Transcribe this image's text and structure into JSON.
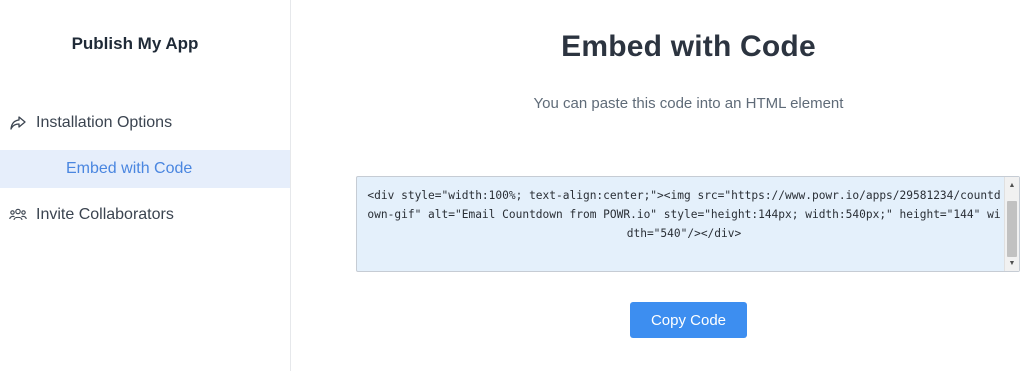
{
  "sidebar": {
    "title": "Publish My App",
    "items": [
      {
        "label": "Installation Options",
        "icon": "share-arrow-icon"
      },
      {
        "label": "Embed with Code",
        "active": true
      },
      {
        "label": "Invite Collaborators",
        "icon": "users-icon"
      }
    ]
  },
  "main": {
    "title": "Embed with Code",
    "subtitle": "You can paste this code into an HTML element",
    "code": "<div style=\"width:100%; text-align:center;\"><img src=\"https://www.powr.io/apps/29581234/countdown-gif\" alt=\"Email Countdown from POWR.io\" style=\"height:144px; width:540px;\" height=\"144\" width=\"540\"/></div>",
    "copy_button_label": "Copy Code"
  },
  "colors": {
    "accent": "#3d8ef0",
    "active_nav_bg": "#e6eefb",
    "active_nav_text": "#4a86e0",
    "code_bg": "#e4f0fb"
  }
}
